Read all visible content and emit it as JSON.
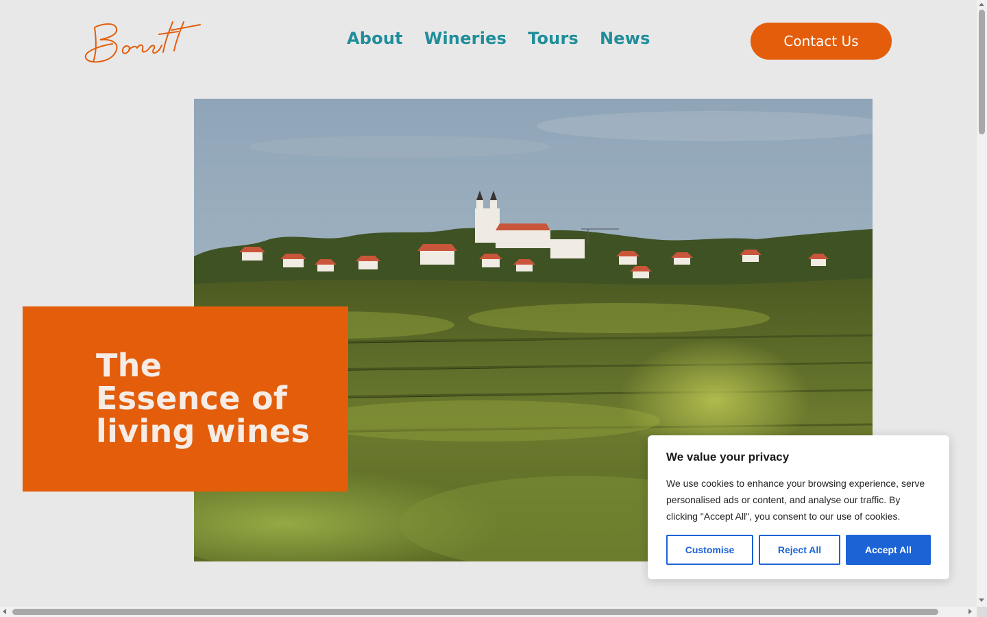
{
  "brand": {
    "logo_text": "Borett",
    "accent_color": "#e35d0b",
    "nav_color": "#1f8e9a"
  },
  "nav": {
    "items": [
      {
        "label": "About"
      },
      {
        "label": "Wineries"
      },
      {
        "label": "Tours"
      },
      {
        "label": "News"
      }
    ],
    "contact_label": "Contact Us"
  },
  "hero": {
    "title_line1": "The",
    "title_line2": "Essence of",
    "title_line3": "living wines"
  },
  "cookie": {
    "title": "We value your privacy",
    "body": "We use cookies to enhance your browsing experience, serve personalised ads or content, and analyse our traffic. By clicking \"Accept All\", you consent to our use of cookies.",
    "customise_label": "Customise",
    "reject_label": "Reject All",
    "accept_label": "Accept All",
    "button_color": "#1c63d6"
  }
}
